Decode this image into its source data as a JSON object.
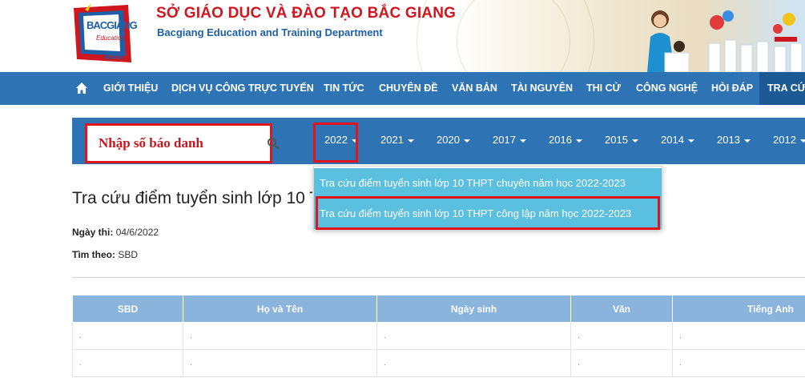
{
  "header": {
    "title": "SỞ GIÁO DỤC VÀ ĐÀO TẠO BẮC GIANG",
    "subtitle": "Bacgiang Education and Training Department",
    "logo": {
      "line1": "BACGIANG",
      "line2": "Education",
      "line3": "wWW"
    }
  },
  "nav": {
    "items": [
      "GIỚI THIỆU",
      "DỊCH VỤ CÔNG TRỰC TUYẾN",
      "TIN TỨC",
      "CHUYÊN ĐỀ",
      "VĂN BẢN",
      "TÀI NGUYÊN",
      "THI CỬ",
      "CÔNG NGHỆ",
      "HỎI ĐÁP",
      "TRA CỨU"
    ]
  },
  "search": {
    "placeholder": "Nhập số báo danh"
  },
  "years": [
    "2022",
    "2021",
    "2020",
    "2017",
    "2016",
    "2015",
    "2014",
    "2013",
    "2012"
  ],
  "dropdown": {
    "items": [
      "Tra cứu điểm tuyển sinh lớp 10 THPT chuyên năm học 2022-2023",
      "Tra cứu điểm tuyển sinh lớp 10 THPT công lập năm học 2022-2023"
    ]
  },
  "content": {
    "heading": "Tra cứu điểm tuyển sinh lớp 10 THPT",
    "exam_date_label": "Ngày thi:",
    "exam_date_value": "04/6/2022",
    "search_by_label": "Tìm theo:",
    "search_by_value": "SBD"
  },
  "table": {
    "headers": [
      "SBD",
      "Họ và Tên",
      "Ngày sinh",
      "Văn",
      "Tiếng Anh"
    ],
    "rows": [
      [
        ".",
        ".",
        ".",
        ".",
        "."
      ],
      [
        ".",
        ".",
        ".",
        ".",
        "."
      ]
    ]
  },
  "colors": {
    "nav_bg": "#2e74b5",
    "accent_red": "#e1141c",
    "dropdown_bg": "#5bbfdf",
    "table_header_bg": "#8ab4dc"
  },
  "icons": {
    "home": "home-icon",
    "search": "search-icon",
    "caret": "caret-down-icon"
  }
}
